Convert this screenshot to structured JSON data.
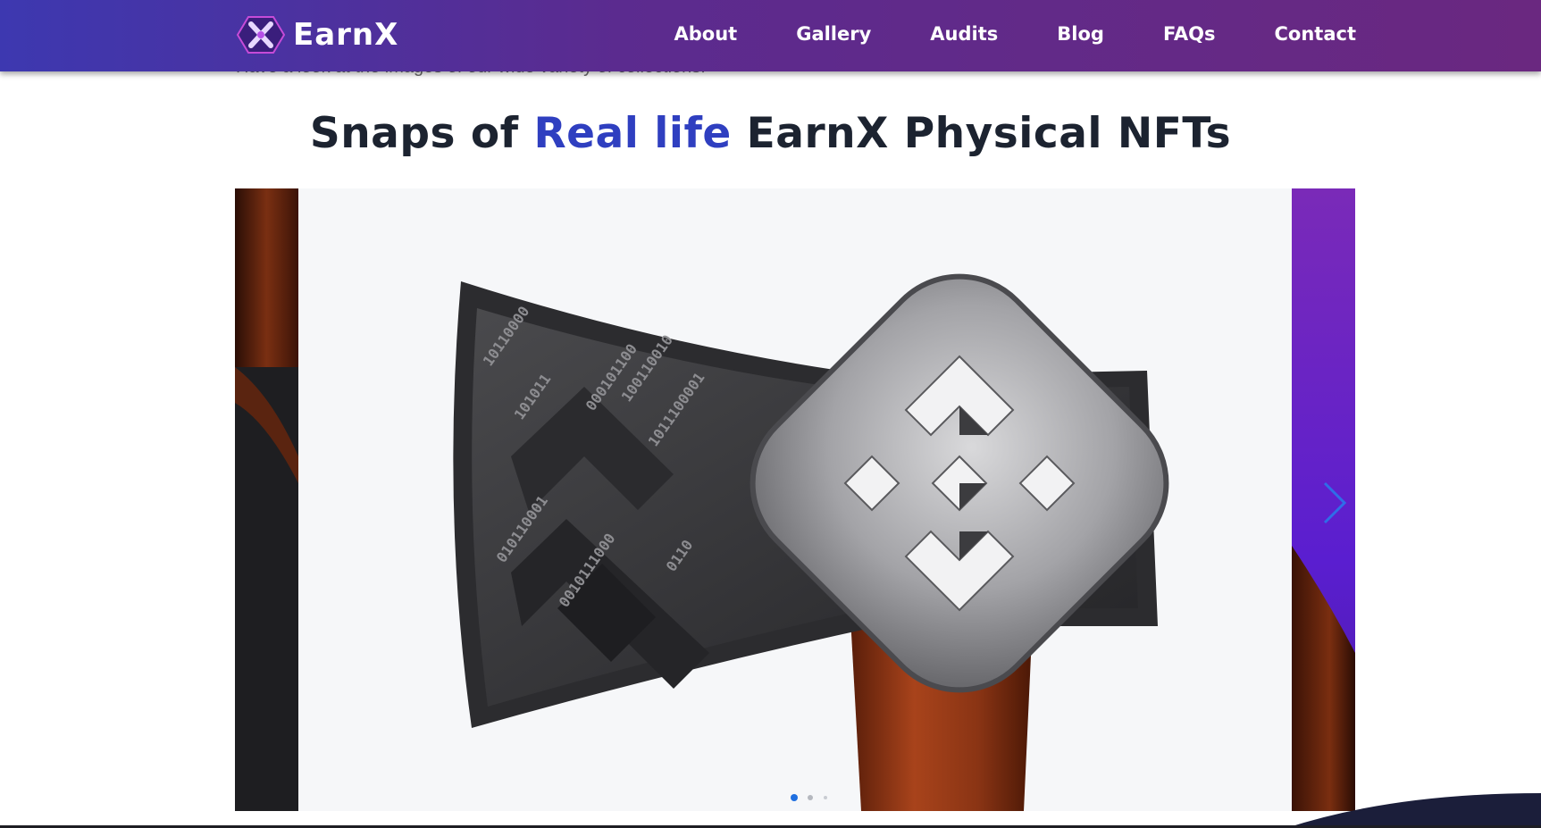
{
  "brand": {
    "name": "EarnX"
  },
  "nav": {
    "items": [
      "About",
      "Gallery",
      "Audits",
      "Blog",
      "FAQs",
      "Contact"
    ]
  },
  "intro": "Have a look at the images of our wide variety of collections.",
  "heading": {
    "part1": "Snaps of ",
    "highlight": "Real life",
    "part2": " EarnX Physical NFTs"
  },
  "colors": {
    "accent": "#2f3fc0",
    "header_start": "#3d38b0",
    "header_end": "#6a2880",
    "dot_active": "#1f6fe0"
  },
  "carousel": {
    "active_index": 0,
    "slide_count": 3,
    "slide_subject": "axe-with-binance-logo-head",
    "engraved_binary": [
      "10110000",
      "101011",
      "000101100",
      "100110010",
      "1011100001",
      "010110001",
      "0010111000",
      "0110"
    ]
  }
}
